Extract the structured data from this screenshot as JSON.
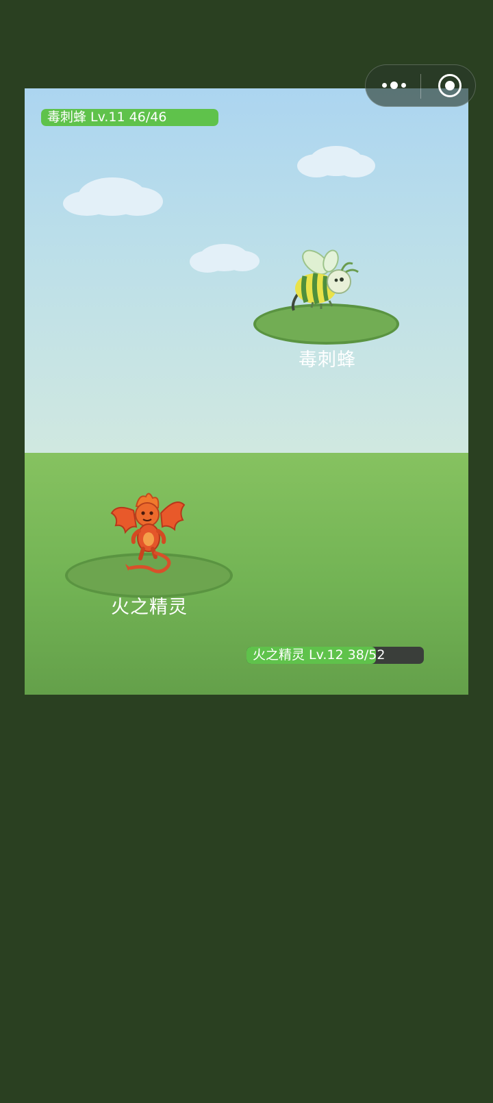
{
  "capsule": {
    "more_icon": "more-dots-icon",
    "close_icon": "target-circle-icon"
  },
  "enemy": {
    "name": "毒刺蜂",
    "hp_label": "毒刺蜂 Lv.11  46/46",
    "hp_current": 46,
    "hp_max": 46,
    "hp_fraction": 1.0,
    "sprite": "poison-bee-sprite"
  },
  "player": {
    "name": "火之精灵",
    "hp_label": "火之精灵 Lv.12  38/52",
    "hp_current": 38,
    "hp_max": 52,
    "hp_fraction": 0.7308,
    "sprite": "fire-spirit-sprite"
  },
  "colors": {
    "background": "#2a4021",
    "hp_fill": "#5fc24b",
    "hp_empty": "#3a3e3a",
    "sky_top": "#acd5f0",
    "ground": "#72b354"
  }
}
